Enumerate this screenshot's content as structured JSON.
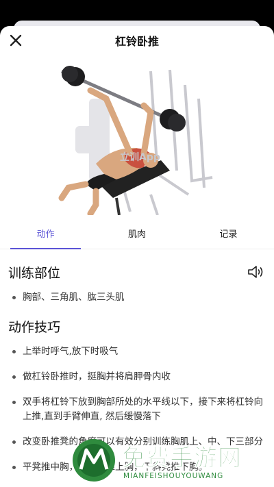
{
  "header": {
    "title": "杠铃卧推"
  },
  "hero": {
    "watermark": "立训App"
  },
  "tabs": [
    {
      "label": "动作"
    },
    {
      "label": "肌肉"
    },
    {
      "label": "记录"
    }
  ],
  "sections": {
    "target": {
      "title": "训练部位",
      "items": [
        "胸部、三角肌、肱三头肌"
      ]
    },
    "technique": {
      "title": "动作技巧",
      "items": [
        "上举时呼气,放下时吸气",
        "做杠铃卧推时，挺胸并将肩胛骨内收",
        "双手将杠铃下放到胸部所处的水平线以下，接下来将杠铃向上推,直到手臂伸直, 然后缓慢落下",
        "改变卧推凳的角度可以有效分别训练胸肌上、中、下三部分",
        "平凳推中胸，上斜凳推上胸，下斜凳推下胸。"
      ]
    }
  },
  "watermark": {
    "text": "免费手游网",
    "url": "MIANFEISHOUYOUWANG"
  },
  "colors": {
    "accent": "#5b53d6",
    "watermark": "#2f8b3e"
  }
}
